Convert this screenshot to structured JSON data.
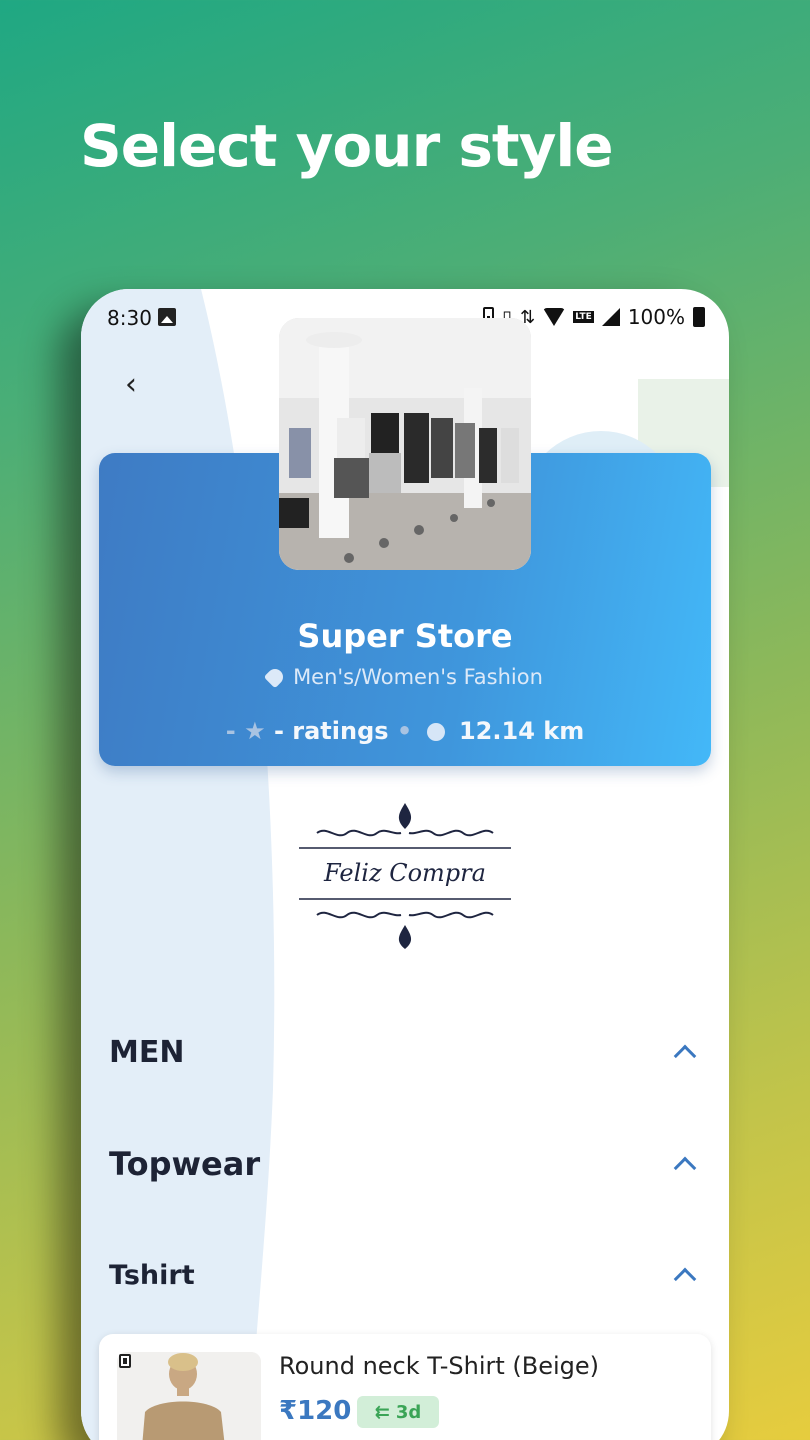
{
  "promo": {
    "title": "Select your style"
  },
  "status_bar": {
    "time": "8:30",
    "battery": "100%",
    "network": "LTE"
  },
  "store": {
    "name": "Super Store",
    "category": "Men's/Women's Fashion",
    "rating": "-",
    "ratings_label": "- ratings",
    "separator": "•",
    "distance": "12.14 km",
    "logo_text": "Feliz Compra"
  },
  "sections": {
    "men": "MEN",
    "topwear": "Topwear",
    "tshirt": "Tshirt"
  },
  "product": {
    "name": "Round neck T-Shirt (Beige)",
    "price": "₹120",
    "return_label": "3d"
  },
  "colors": {
    "accent": "#3b78c0",
    "card_gradient_start": "#3e7bc4",
    "card_gradient_end": "#43b8f8",
    "return_badge_bg": "#d2eed8",
    "return_badge_text": "#3aa456"
  }
}
